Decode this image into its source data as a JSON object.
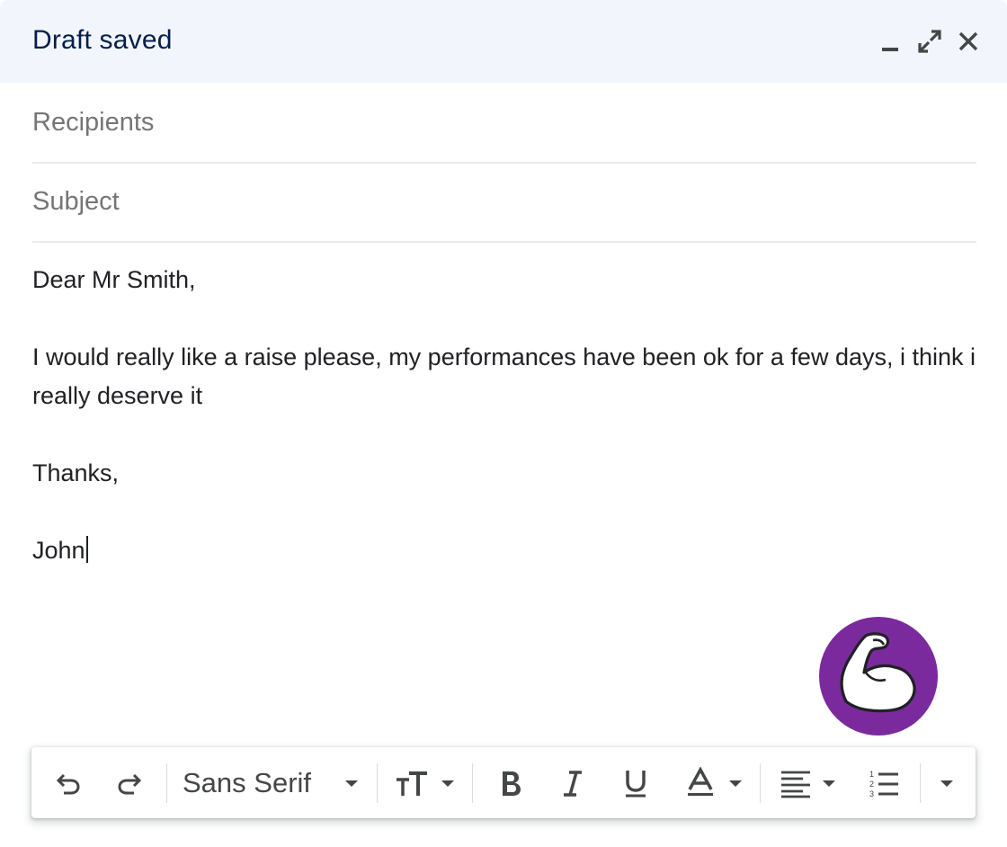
{
  "header": {
    "title": "Draft saved",
    "minimize_icon": "minimize-icon",
    "expand_icon": "expand-icon",
    "close_icon": "close-icon"
  },
  "recipients": {
    "placeholder": "Recipients",
    "value": ""
  },
  "subject": {
    "placeholder": "Subject",
    "value": ""
  },
  "body": {
    "greeting": "Dear Mr Smith,",
    "paragraph": "I would really like a raise please, my performances have been ok for a few days, i think i really deserve it",
    "closing": "Thanks,",
    "signature": "John"
  },
  "fab": {
    "icon": "flexed-bicep-icon",
    "color": "#7b2a9e"
  },
  "toolbar": {
    "font": "Sans Serif",
    "items": [
      "undo-icon",
      "redo-icon",
      "font-dropdown",
      "text-size-icon",
      "bold-icon",
      "italic-icon",
      "underline-icon",
      "text-color-icon",
      "align-icon",
      "numbered-list-icon",
      "more-options-icon"
    ]
  },
  "colors": {
    "header_bg": "#f2f6fc",
    "title": "#041e49",
    "placeholder": "#757575"
  }
}
